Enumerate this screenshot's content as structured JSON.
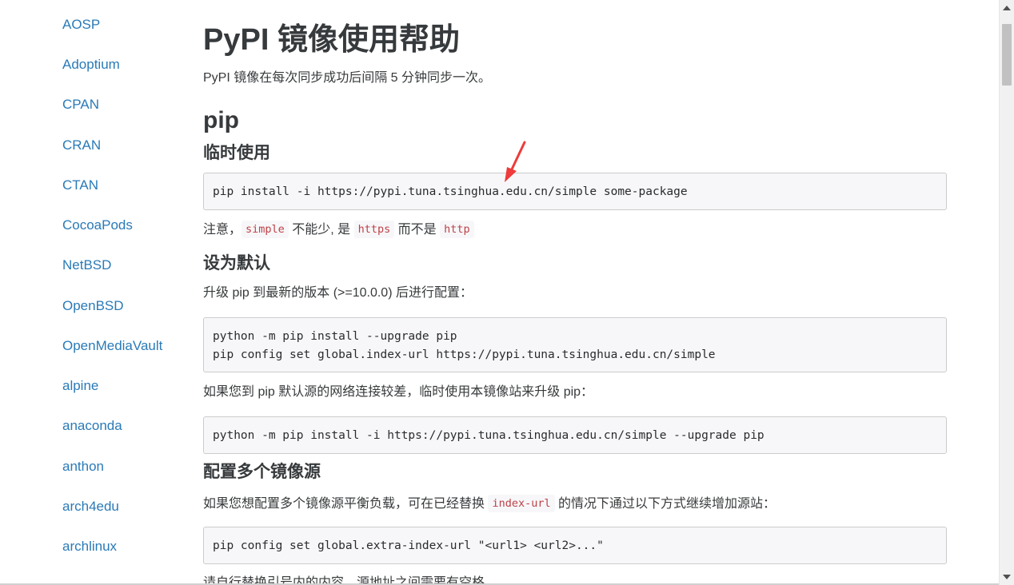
{
  "sidebar": {
    "items": [
      {
        "label": "AOSP"
      },
      {
        "label": "Adoptium"
      },
      {
        "label": "CPAN"
      },
      {
        "label": "CRAN"
      },
      {
        "label": "CTAN"
      },
      {
        "label": "CocoaPods"
      },
      {
        "label": "NetBSD"
      },
      {
        "label": "OpenBSD"
      },
      {
        "label": "OpenMediaVault"
      },
      {
        "label": "alpine"
      },
      {
        "label": "anaconda"
      },
      {
        "label": "anthon"
      },
      {
        "label": "arch4edu"
      },
      {
        "label": "archlinux"
      }
    ]
  },
  "main": {
    "title": "PyPI 镜像使用帮助",
    "intro": "PyPI 镜像在每次同步成功后间隔 5 分钟同步一次。",
    "pip_heading": "pip",
    "temp_heading": "临时使用",
    "temp_code": "pip install -i https://pypi.tuna.tsinghua.edu.cn/simple some-package",
    "note": {
      "prefix": "注意，",
      "code1": "simple",
      "mid1": " 不能少, 是 ",
      "code2": "https",
      "mid2": " 而不是 ",
      "code3": "http"
    },
    "default_heading": "设为默认",
    "default_intro": "升级 pip 到最新的版本 (>=10.0.0) 后进行配置：",
    "default_code": {
      "line1": "python -m pip install --upgrade pip",
      "line2": "pip config set global.index-url https://pypi.tuna.tsinghua.edu.cn/simple"
    },
    "slow_text": "如果您到 pip 默认源的网络连接较差，临时使用本镜像站来升级 pip：",
    "slow_code": "python -m pip install -i https://pypi.tuna.tsinghua.edu.cn/simple --upgrade pip",
    "multi_heading": "配置多个镜像源",
    "multi_text": {
      "prefix": "如果您想配置多个镜像源平衡负载，可在已经替换 ",
      "code": "index-url",
      "suffix": " 的情况下通过以下方式继续增加源站："
    },
    "multi_code": "pip config set global.extra-index-url \"<url1> <url2>...\"",
    "tail_text": "请自行替换引号内的内容，源地址之间需要有空格"
  },
  "colors": {
    "link": "#2a7ab7",
    "text": "#373a3c",
    "code_text": "#bd4147",
    "code_bg": "#f7f7f9",
    "annotation_arrow": "#ee3b3b"
  },
  "icons": {
    "annotation": "red-arrow-icon",
    "scroll_up": "scroll-up-arrow-icon",
    "scroll_down": "scroll-down-arrow-icon"
  }
}
